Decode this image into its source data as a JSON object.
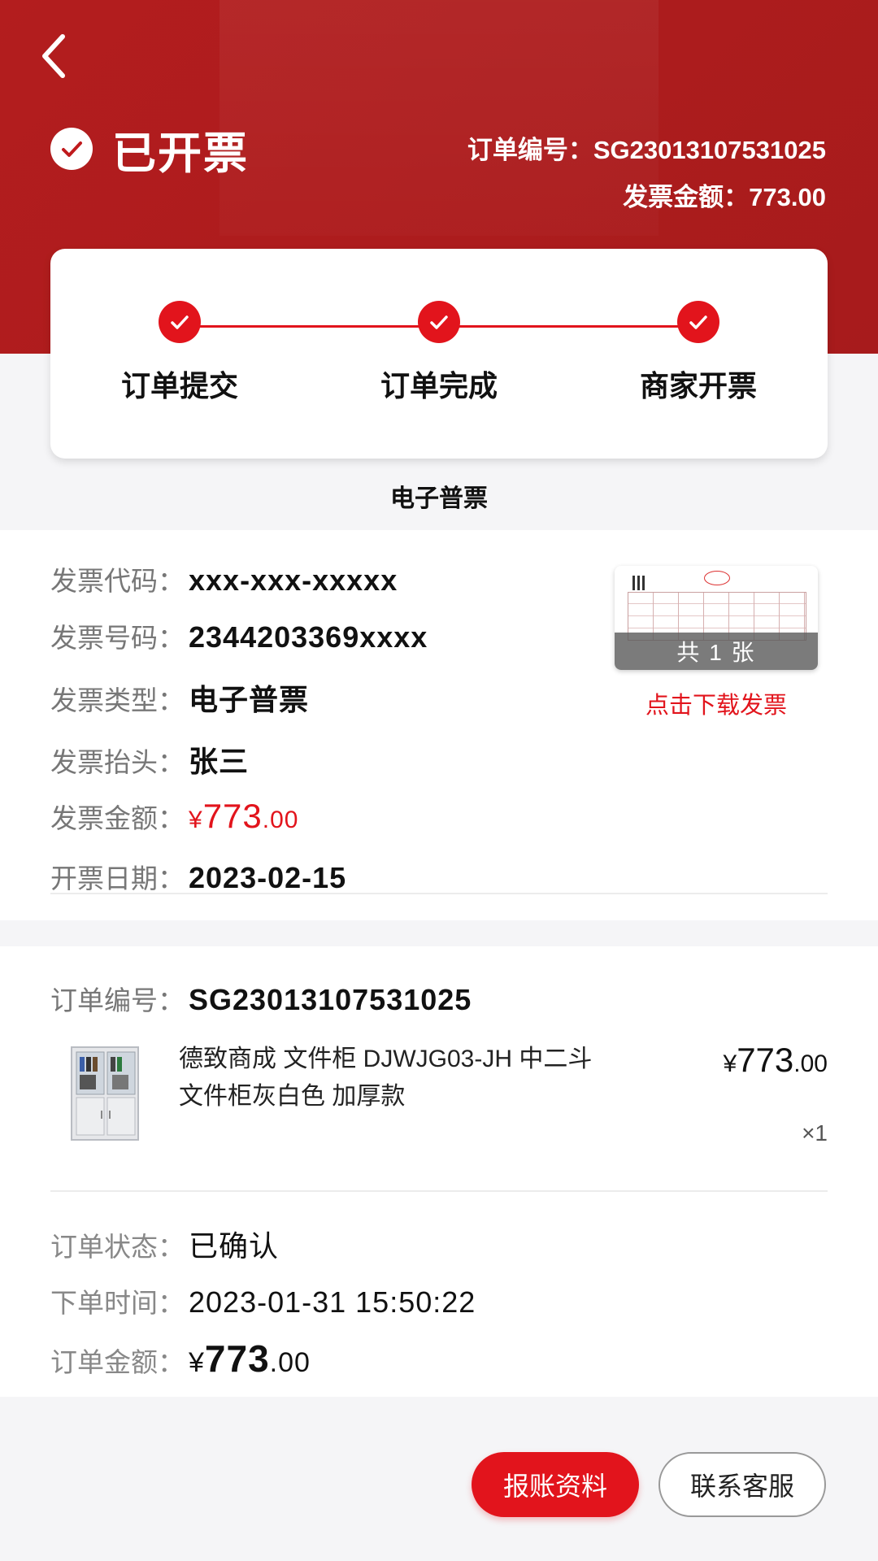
{
  "header": {
    "status_title": "已开票",
    "order_no_text": "订单编号：SG23013107531025",
    "amount_text": "发票金额：773.00"
  },
  "progress": {
    "steps": [
      {
        "label": "订单提交"
      },
      {
        "label": "订单完成"
      },
      {
        "label": "商家开票"
      }
    ]
  },
  "invoice": {
    "kind_label": "电子普票",
    "rows": {
      "code": {
        "key": "发票代码：",
        "value": "xxx-xxx-xxxxx"
      },
      "number": {
        "key": "发票号码：",
        "value": "2344203369xxxx"
      },
      "type": {
        "key": "发票类型：",
        "value": "电子普票"
      },
      "title": {
        "key": "发票抬头：",
        "value": "张三"
      },
      "amount": {
        "key": "发票金额：",
        "currency": "¥",
        "integer": "773",
        "decimal": ".00"
      },
      "date": {
        "key": "开票日期：",
        "value": "2023-02-15"
      }
    },
    "thumbnail_caption": "共 1 张",
    "download_label": "点击下载发票"
  },
  "order": {
    "id_key": "订单编号：",
    "id_value": "SG23013107531025",
    "product": {
      "name": "德致商成 文件柜 DJWJG03-JH 中二斗文件柜灰白色 加厚款",
      "price_currency": "¥",
      "price_integer": "773",
      "price_decimal": ".00",
      "quantity": "×1"
    },
    "status": {
      "key": "订单状态：",
      "value": "已确认"
    },
    "time": {
      "key": "下单时间：",
      "value": "2023-01-31 15:50:22"
    },
    "amount": {
      "key": "订单金额：",
      "currency": "¥",
      "integer": "773",
      "decimal": ".00"
    }
  },
  "actions": {
    "expense_label": "报账资料",
    "service_label": "联系客服"
  },
  "colors": {
    "brand_red": "#e2141c",
    "header_red": "#b31d1e"
  }
}
